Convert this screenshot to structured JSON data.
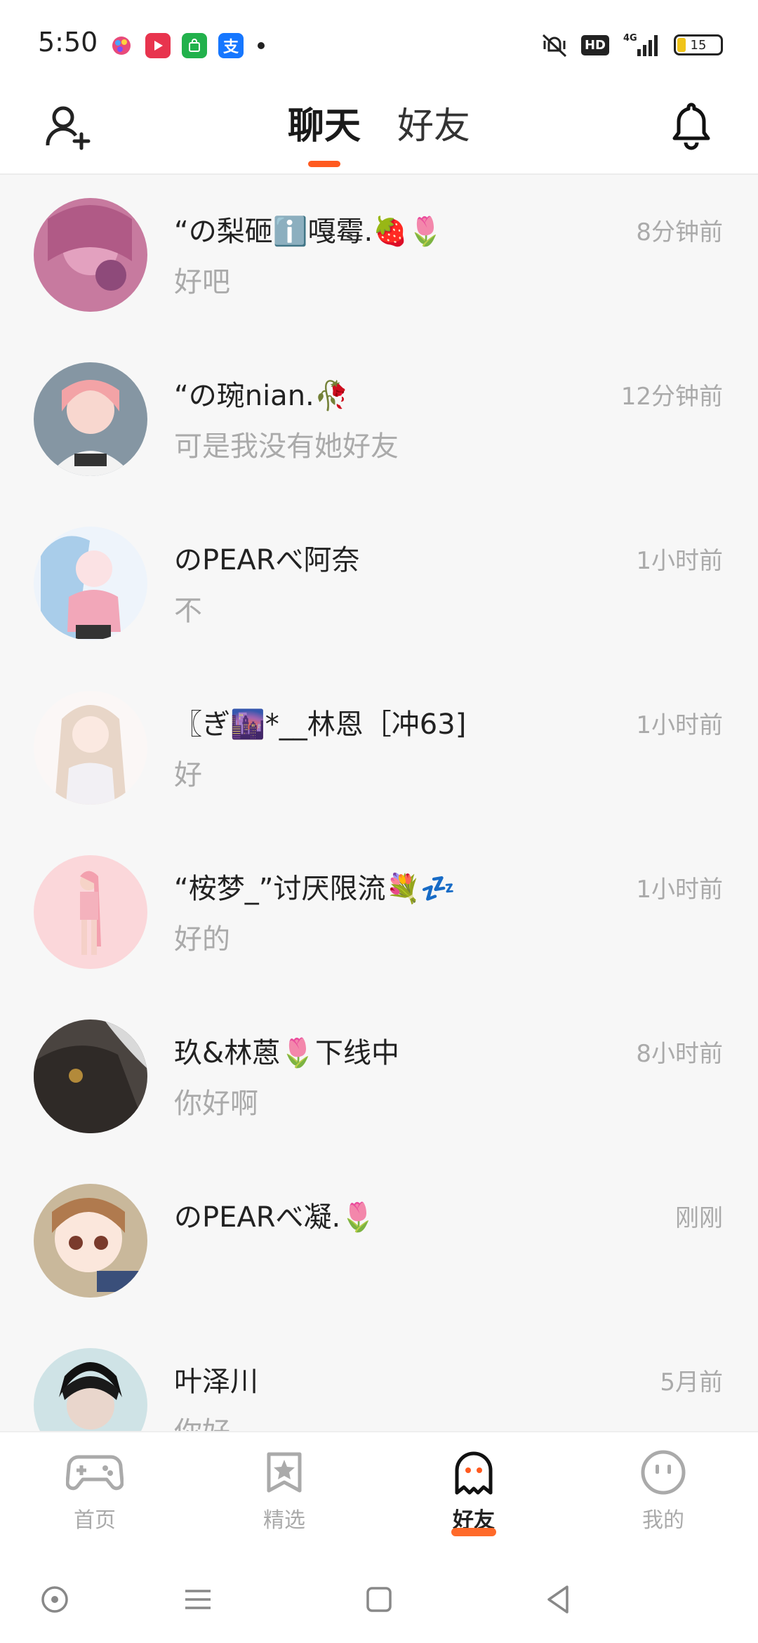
{
  "status_bar": {
    "time": "5:50",
    "network": "4G",
    "hd_label": "HD",
    "battery": "15"
  },
  "header": {
    "tabs": [
      {
        "label": "聊天",
        "active": true
      },
      {
        "label": "好友",
        "active": false
      }
    ]
  },
  "chats": [
    {
      "name": "“の梨砸ℹ️嘎霉.🍓🌷",
      "message": "好吧",
      "time": "8分钟前"
    },
    {
      "name": "“の琬nian.🥀",
      "message": "可是我没有她好友",
      "time": "12分钟前"
    },
    {
      "name": "のPEARべ阿奈",
      "message": "不",
      "time": "1小时前"
    },
    {
      "name": "〖ぎ🌆*__林恩［冲63]",
      "message": "好",
      "time": "1小时前"
    },
    {
      "name": "“桉梦_”讨厌限流💐💤",
      "message": "好的",
      "time": "1小时前"
    },
    {
      "name": "玖&林蒽🌷下线中",
      "message": "你好啊",
      "time": "8小时前"
    },
    {
      "name": "のPEARべ凝.🌷",
      "message": "",
      "time": "刚刚"
    },
    {
      "name": "叶泽川",
      "message": "你好",
      "time": "5月前"
    }
  ],
  "bottom_nav": [
    {
      "label": "首页",
      "icon": "gamepad-icon"
    },
    {
      "label": "精选",
      "icon": "star-bookmark-icon"
    },
    {
      "label": "好友",
      "icon": "ghost-icon",
      "active": true
    },
    {
      "label": "我的",
      "icon": "smiley-icon"
    }
  ],
  "colors": {
    "accent": "#ff5a1f",
    "background": "#f7f7f7",
    "secondary_text": "#aaaaaa"
  }
}
